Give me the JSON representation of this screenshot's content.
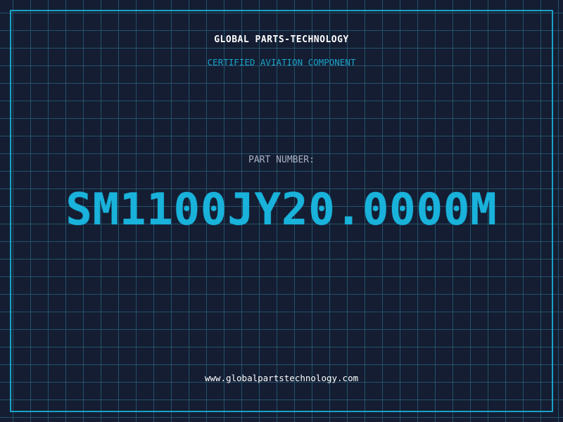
{
  "header": {
    "company": "GLOBAL PARTS-TECHNOLOGY",
    "subtitle": "CERTIFIED AVIATION COMPONENT"
  },
  "main": {
    "label": "PART NUMBER:",
    "part_number": "SM1100JY20.0000M"
  },
  "footer": {
    "website": "www.globalpartstechnology.com"
  },
  "colors": {
    "background": "#141d32",
    "grid": "#24526a",
    "accent": "#1aa3c9",
    "part_number": "#19b2db",
    "text": "#ffffff"
  }
}
